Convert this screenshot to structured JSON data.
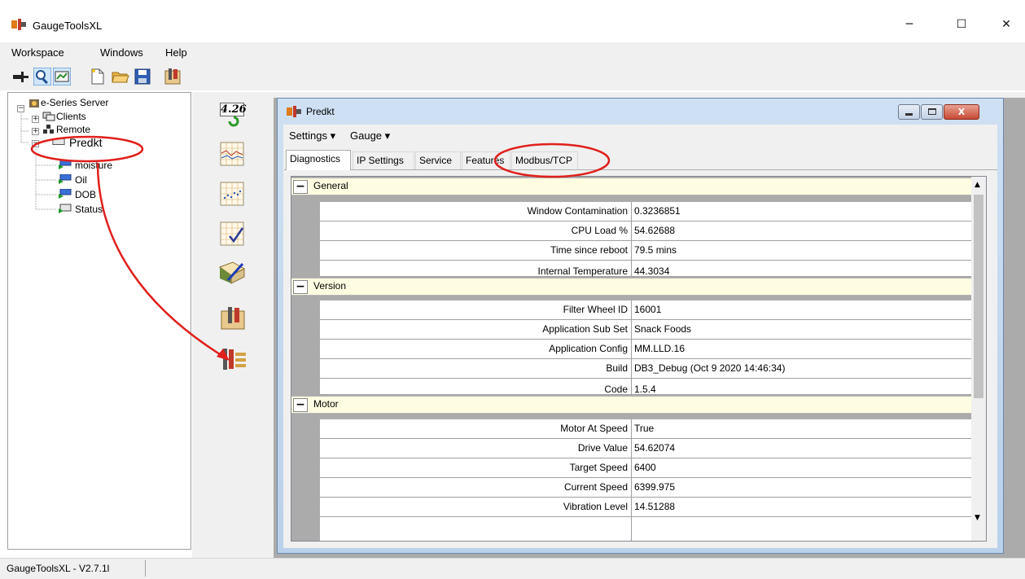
{
  "app": {
    "title": "GaugeToolsXL"
  },
  "window_controls": {
    "minimize": "─",
    "maximize": "☐",
    "close": "✕"
  },
  "menu": [
    "Workspace",
    "Windows",
    "Help"
  ],
  "toolbar": {
    "icons": [
      "pin-icon",
      "zoom-icon",
      "view-icon",
      "new-file-icon",
      "open-folder-icon",
      "save-icon",
      "tools-icon"
    ]
  },
  "tree": {
    "root": "e-Series Server",
    "children": [
      "Clients",
      "Remote",
      "Predkt"
    ],
    "predkt_children": [
      "moisture",
      "Oil",
      "DOB",
      "Status"
    ]
  },
  "side_icons": {
    "version_badge": "4.26"
  },
  "child_window": {
    "title": "Predkt",
    "menu": [
      "Settings ▾",
      "Gauge ▾"
    ],
    "tabs": [
      "Diagnostics",
      "IP Settings",
      "Service",
      "Features",
      "Modbus/TCP"
    ],
    "active_tab": "Diagnostics"
  },
  "grid": {
    "categories": [
      {
        "name": "General",
        "rows": [
          {
            "label": "Window Contamination",
            "value": "0.3236851"
          },
          {
            "label": "CPU Load %",
            "value": "54.62688"
          },
          {
            "label": "Time since reboot",
            "value": "79.5 mins"
          },
          {
            "label": "Internal Temperature",
            "value": "44.3034"
          }
        ]
      },
      {
        "name": "Version",
        "rows": [
          {
            "label": "Filter Wheel ID",
            "value": "16001"
          },
          {
            "label": "Application Sub Set",
            "value": "Snack Foods"
          },
          {
            "label": "Application Config",
            "value": "MM.LLD.16"
          },
          {
            "label": "Build",
            "value": "DB3_Debug (Oct  9 2020 14:46:34)"
          },
          {
            "label": "Code",
            "value": "1.5.4"
          }
        ]
      },
      {
        "name": "Motor",
        "rows": [
          {
            "label": "Motor At Speed",
            "value": "True"
          },
          {
            "label": "Drive Value",
            "value": "54.62074"
          },
          {
            "label": "Target Speed",
            "value": "6400"
          },
          {
            "label": "Current Speed",
            "value": "6399.975"
          },
          {
            "label": "Vibration Level",
            "value": "14.51288"
          }
        ]
      }
    ]
  },
  "status": {
    "text": "GaugeToolsXL - V2.7.1l"
  },
  "annotation_color": "#e0201c"
}
